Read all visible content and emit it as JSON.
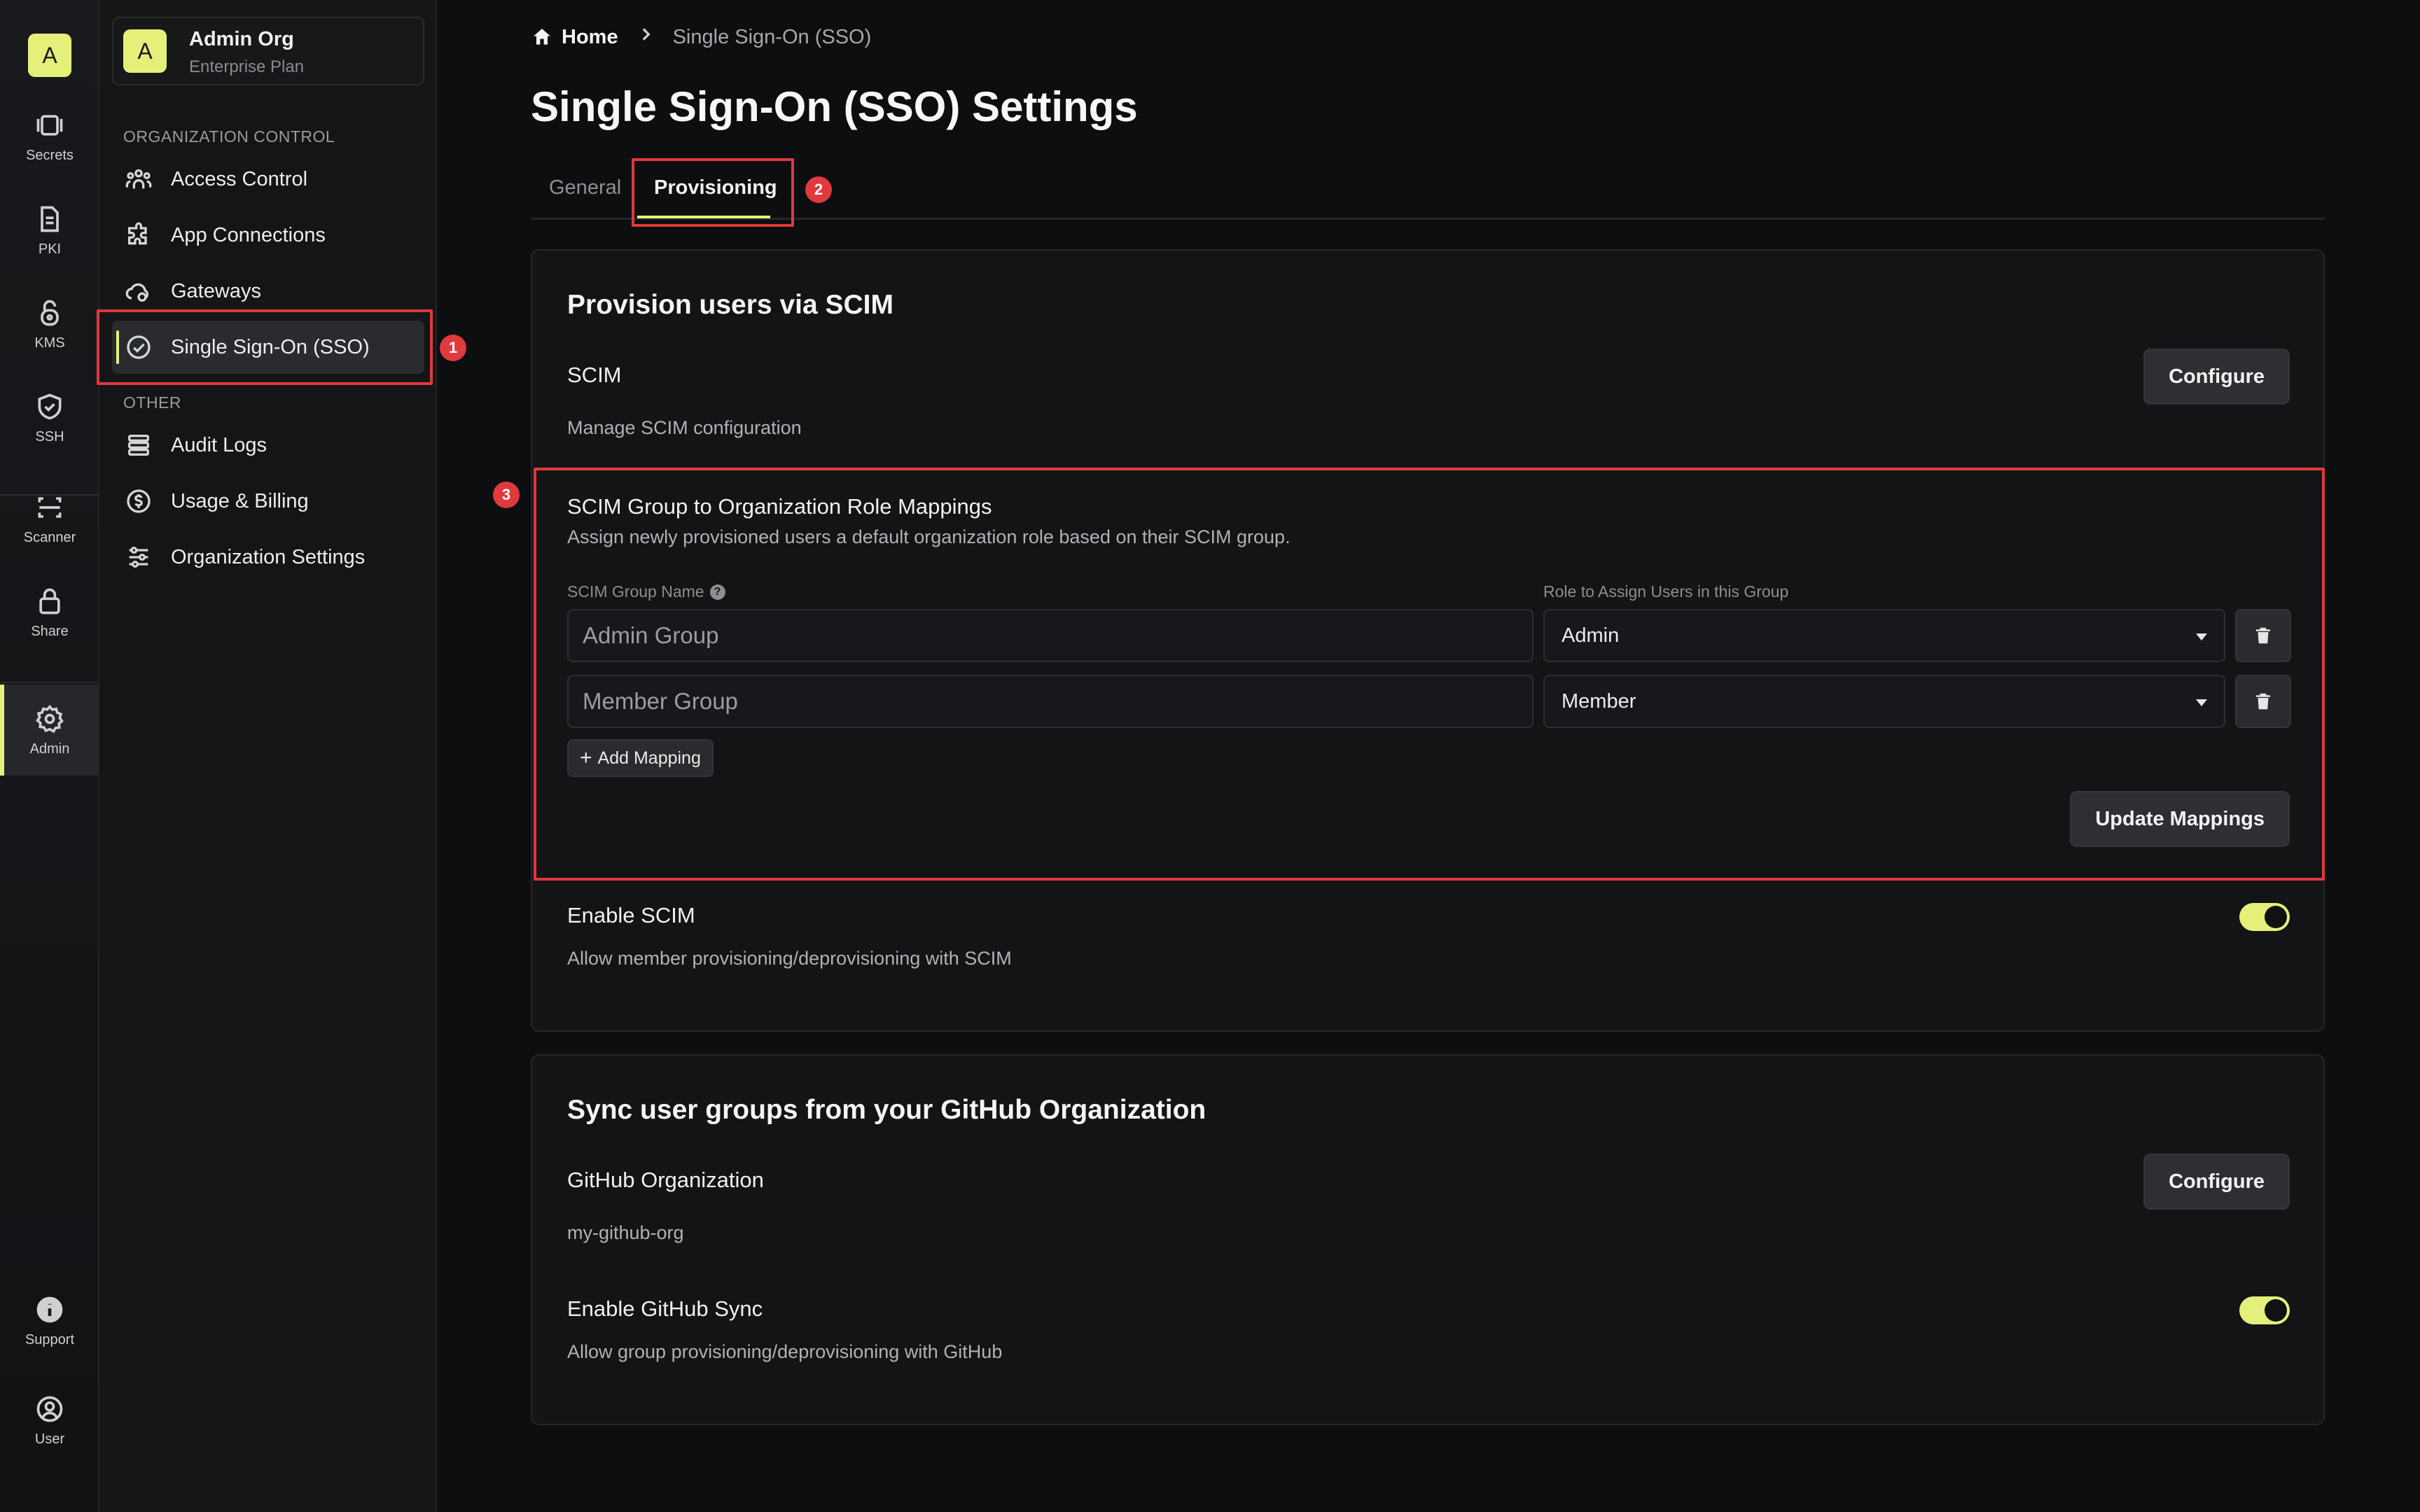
{
  "rail": {
    "logo": "A",
    "items": [
      {
        "label": "Secrets",
        "icon": "secrets-icon"
      },
      {
        "label": "PKI",
        "icon": "pki-icon"
      },
      {
        "label": "KMS",
        "icon": "kms-icon"
      },
      {
        "label": "SSH",
        "icon": "ssh-icon"
      },
      {
        "label": "Scanner",
        "icon": "scanner-icon"
      },
      {
        "label": "Share",
        "icon": "share-icon"
      },
      {
        "label": "Admin",
        "icon": "admin-gear-icon"
      },
      {
        "label": "Support",
        "icon": "support-icon"
      },
      {
        "label": "User",
        "icon": "user-icon"
      }
    ]
  },
  "org": {
    "avatar": "A",
    "name": "Admin Org",
    "plan": "Enterprise Plan"
  },
  "sidebar": {
    "section1": "ORGANIZATION CONTROL",
    "section2": "OTHER",
    "items": [
      {
        "label": "Access Control"
      },
      {
        "label": "App Connections"
      },
      {
        "label": "Gateways"
      },
      {
        "label": "Single Sign-On (SSO)"
      },
      {
        "label": "Audit Logs"
      },
      {
        "label": "Usage & Billing"
      },
      {
        "label": "Organization Settings"
      }
    ]
  },
  "annotations": {
    "b1": "1",
    "b2": "2",
    "b3": "3"
  },
  "breadcrumb": {
    "home": "Home",
    "current": "Single Sign-On (SSO)"
  },
  "page": {
    "title": "Single Sign-On (SSO) Settings"
  },
  "tabs": [
    {
      "label": "General"
    },
    {
      "label": "Provisioning"
    }
  ],
  "scim_card": {
    "title": "Provision users via SCIM",
    "scim_title": "SCIM",
    "scim_desc": "Manage SCIM configuration",
    "configure_label": "Configure",
    "mappings": {
      "title": "SCIM Group to Organization Role Mappings",
      "desc": "Assign newly provisioned users a default organization role based on their SCIM group.",
      "group_label": "SCIM Group Name",
      "role_label": "Role to Assign Users in this Group",
      "rows": [
        {
          "group": "Admin Group",
          "role": "Admin"
        },
        {
          "group": "Member Group",
          "role": "Member"
        }
      ],
      "add_label": "Add Mapping",
      "update_label": "Update Mappings"
    },
    "enable_title": "Enable SCIM",
    "enable_desc": "Allow member provisioning/deprovisioning with SCIM",
    "enable_on": true
  },
  "github_card": {
    "title": "Sync user groups from your GitHub Organization",
    "org_title": "GitHub Organization",
    "org_value": "my-github-org",
    "configure_label": "Configure",
    "sync_title": "Enable GitHub Sync",
    "sync_desc": "Allow group provisioning/deprovisioning with GitHub",
    "sync_on": true
  },
  "colors": {
    "accent": "#e5f07a",
    "highlight": "#e0393e",
    "background": "#0d0e10"
  }
}
